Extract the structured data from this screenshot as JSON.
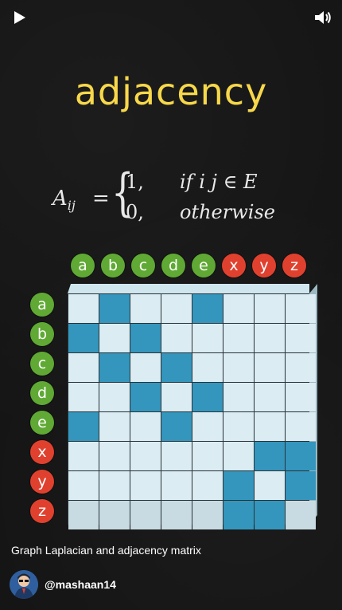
{
  "player": {
    "play_icon": "play-icon",
    "volume_icon": "volume-icon"
  },
  "title": "adjacency",
  "formula": {
    "lhs": "A",
    "lhs_sub": "ij",
    "eq": "=",
    "case1_value": "1,",
    "case1_condition": "if i j ∈ E",
    "case2_value": "0,",
    "case2_condition": "otherwise"
  },
  "nodes": {
    "columns": [
      "a",
      "b",
      "c",
      "d",
      "e",
      "x",
      "y",
      "z"
    ],
    "rows": [
      "a",
      "b",
      "c",
      "d",
      "e",
      "x",
      "y",
      "z"
    ],
    "colors": {
      "a": "green",
      "b": "green",
      "c": "green",
      "d": "green",
      "e": "green",
      "x": "red",
      "y": "red",
      "z": "red"
    }
  },
  "matrix": [
    [
      0,
      1,
      0,
      0,
      1,
      0,
      0,
      0
    ],
    [
      1,
      0,
      1,
      0,
      0,
      0,
      0,
      0
    ],
    [
      0,
      1,
      0,
      1,
      0,
      0,
      0,
      0
    ],
    [
      0,
      0,
      1,
      0,
      1,
      0,
      0,
      0
    ],
    [
      1,
      0,
      0,
      1,
      0,
      0,
      0,
      0
    ],
    [
      0,
      0,
      0,
      0,
      0,
      0,
      1,
      1
    ],
    [
      0,
      0,
      0,
      0,
      0,
      1,
      0,
      1
    ],
    [
      0,
      0,
      0,
      0,
      0,
      1,
      1,
      0
    ]
  ],
  "caption": "Graph Laplacian and adjacency matrix",
  "channel": {
    "handle": "@mashaan14",
    "avatar_icon": "avatar"
  },
  "colors": {
    "title": "#f7d84a",
    "green_node": "#5fa934",
    "red_node": "#e0412f",
    "cell_on": "#3596bd",
    "cell_off": "#dcecf3"
  }
}
